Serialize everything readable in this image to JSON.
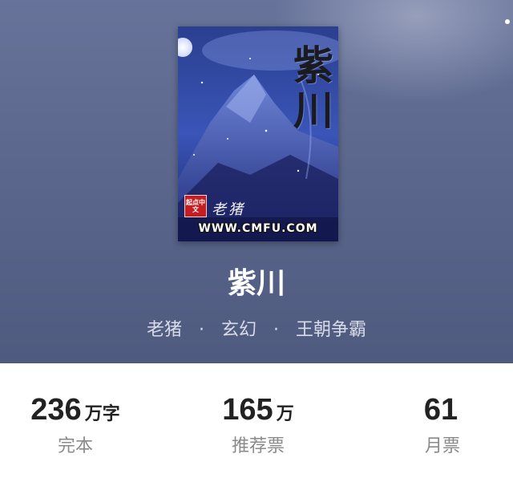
{
  "book": {
    "title": "紫川",
    "cover": {
      "title_art": "紫川",
      "author_art": "老猪",
      "site": "WWW.CMFU.COM",
      "badge": "起点中文"
    },
    "author": "老猪",
    "separator": "·",
    "genre": "玄幻",
    "subgenre": "王朝争霸"
  },
  "stats": [
    {
      "value": "236",
      "unit": "万字",
      "label": "完本"
    },
    {
      "value": "165",
      "unit": "万",
      "label": "推荐票"
    },
    {
      "value": "61",
      "unit": "",
      "label": "月票"
    }
  ],
  "colors": {
    "hero_top": "#67739a",
    "hero_bottom": "#4f5a7f",
    "stat_value": "#222222",
    "stat_label": "#8a8a8a"
  }
}
